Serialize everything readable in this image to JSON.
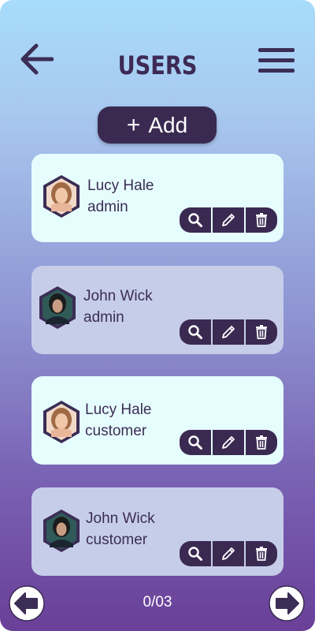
{
  "header": {
    "title": "USERS",
    "back_icon": "arrow-left-icon",
    "menu_icon": "hamburger-menu-icon"
  },
  "add_button": {
    "label": "+ Add",
    "plus": "+",
    "text": "Add"
  },
  "users": [
    {
      "name": "Lucy Hale",
      "role": "admin",
      "avatar": "female-avatar"
    },
    {
      "name": "John Wick",
      "role": "admin",
      "avatar": "male-avatar"
    },
    {
      "name": "Lucy Hale",
      "role": "customer",
      "avatar": "female-avatar"
    },
    {
      "name": "John Wick",
      "role": "customer",
      "avatar": "male-avatar"
    }
  ],
  "actions": [
    "search-icon",
    "pencil-icon",
    "trash-icon"
  ],
  "pager": {
    "count": "0/03",
    "prev_icon": "arrow-left-circle-icon",
    "next_icon": "arrow-right-circle-icon"
  },
  "colors": {
    "dark": "#3a2a52",
    "card_light": "#e6fdfd",
    "card_dim": "#c6cde9",
    "gradient_top": "#a7dcfb",
    "gradient_bottom": "#6a3f98"
  }
}
